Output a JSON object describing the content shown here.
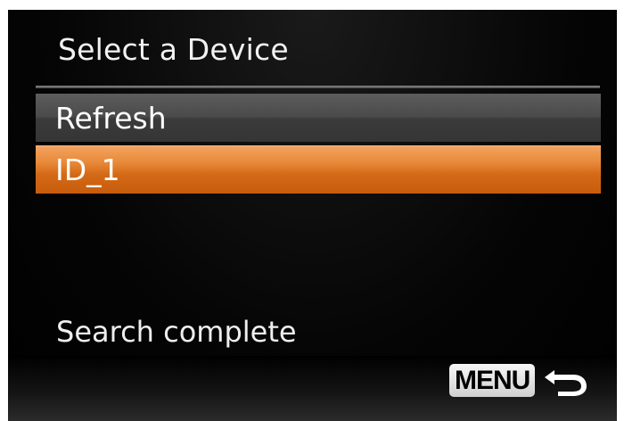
{
  "screen": {
    "title": "Select a Device",
    "items": [
      {
        "label": "Refresh",
        "selected": false
      },
      {
        "label": "ID_1",
        "selected": true
      }
    ],
    "status": "Search complete",
    "menu_button": {
      "label": "MENU",
      "icon": "return-arrow-icon"
    }
  }
}
